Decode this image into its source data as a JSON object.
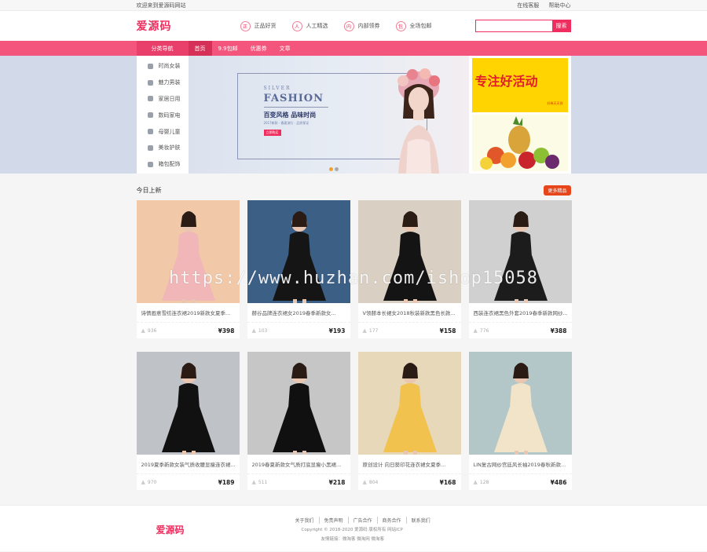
{
  "topbar": {
    "welcome": "欢迎来到爱源码网站",
    "service": "在线客服",
    "help": "帮助中心"
  },
  "header": {
    "logo": "爱源码",
    "promises": [
      {
        "icon": "正",
        "label": "正品好货"
      },
      {
        "icon": "人",
        "label": "人工精选"
      },
      {
        "icon": "内",
        "label": "内部领券"
      },
      {
        "icon": "包",
        "label": "全场包邮"
      }
    ],
    "search": {
      "placeholder": "",
      "button": "搜索"
    }
  },
  "nav": {
    "category_head": "分类导航",
    "items": [
      "首页",
      "9.9包邮",
      "优惠券",
      "文章"
    ]
  },
  "categories": [
    "时尚女装",
    "魅力男装",
    "家居日用",
    "数码家电",
    "母婴儿童",
    "美妆护肤",
    "箱包配饰"
  ],
  "hero": {
    "silver": "SILVER",
    "fashion": "FASHION",
    "slogan": "百变风格  品味时尚",
    "sub": "2017新款 · 春夏流行 · 品质保证",
    "button": "立即购买",
    "deco": "FN\nIO\nA"
  },
  "side_ad": {
    "text": "专注好活动",
    "small": "好券天天领"
  },
  "section": {
    "title": "今日上新",
    "more": "更多精品"
  },
  "products": [
    {
      "name": "诗情画意雪纺连衣裙2019新款女夏季...",
      "views": "936",
      "price": "¥398",
      "bg": "#f2c9a8",
      "dress": "#f1b6b7"
    },
    {
      "name": "赫谷品牌连衣裙女2019春季新款女...",
      "views": "103",
      "price": "¥193",
      "bg": "#3c5f86",
      "dress": "#151515"
    },
    {
      "name": "V领赫本长裙女2018秋装新款黑色长款...",
      "views": "177",
      "price": "¥158",
      "bg": "#d9cfc3",
      "dress": "#141414"
    },
    {
      "name": "西装连衣裙黑色外套2019春季新款网纱...",
      "views": "776",
      "price": "¥388",
      "bg": "#cfd0cf",
      "dress": "#1c1c1c"
    },
    {
      "name": "2019夏季新款女装气质收腰显瘦连衣裙...",
      "views": "970",
      "price": "¥189",
      "bg": "#bfc3c7",
      "dress": "#111111"
    },
    {
      "name": "2019春夏新款女气质打底显瘦小黑裙...",
      "views": "511",
      "price": "¥218",
      "bg": "#c6c6c6",
      "dress": "#101010"
    },
    {
      "name": "原创设计 向日葵印花连衣裙女夏季...",
      "views": "804",
      "price": "¥168",
      "bg": "#e6d8b8",
      "dress": "#f1c24e"
    },
    {
      "name": "LIN复古网纱宫廷风长袖2019春秋新款...",
      "views": "128",
      "price": "¥486",
      "bg": "#b4c7c8",
      "dress": "#f1e4c8"
    }
  ],
  "watermark": "https://www.huzhan.com/ishop15058",
  "footer": {
    "logo": "爱源码",
    "links": [
      "关于我们",
      "免责声明",
      "广告合作",
      "商务合作",
      "联系我们"
    ],
    "copyright": "Copyright © 2018-2020 爱源码 版权所有 网站ICP",
    "friends": "友情链接：微淘客  微淘网  微淘客"
  },
  "colors": {
    "brand": "#ef2d5e",
    "nav": "#f4557c",
    "more": "#e8461a"
  }
}
